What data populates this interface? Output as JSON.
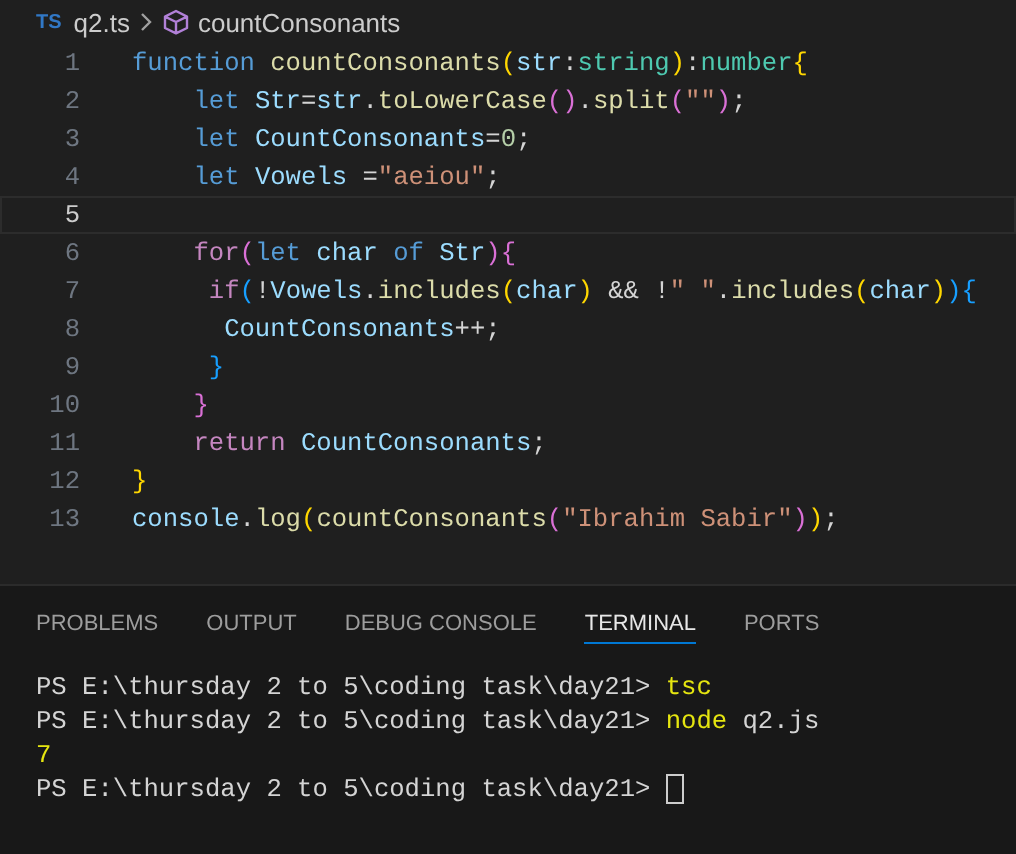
{
  "breadcrumbs": {
    "file_badge": "TS",
    "file": "q2.ts",
    "symbol": "countConsonants"
  },
  "editor": {
    "lines": [
      {
        "number": "1",
        "current": false,
        "tokens": [
          {
            "text": "function ",
            "kind": "keyword"
          },
          {
            "text": "countConsonants",
            "kind": "function"
          },
          {
            "text": "(",
            "kind": "bracket1"
          },
          {
            "text": "str",
            "kind": "variable"
          },
          {
            "text": ":",
            "kind": "plain"
          },
          {
            "text": "string",
            "kind": "type"
          },
          {
            "text": ")",
            "kind": "bracket1"
          },
          {
            "text": ":",
            "kind": "plain"
          },
          {
            "text": "number",
            "kind": "type"
          },
          {
            "text": "{",
            "kind": "bracket1"
          }
        ]
      },
      {
        "number": "2",
        "current": false,
        "tokens": [
          {
            "text": "    let",
            "kind": "keyword"
          },
          {
            "text": " Str",
            "kind": "variable"
          },
          {
            "text": "=",
            "kind": "plain"
          },
          {
            "text": "str",
            "kind": "variable"
          },
          {
            "text": ".",
            "kind": "plain"
          },
          {
            "text": "toLowerCase",
            "kind": "function"
          },
          {
            "text": "()",
            "kind": "bracket2"
          },
          {
            "text": ".",
            "kind": "plain"
          },
          {
            "text": "split",
            "kind": "function"
          },
          {
            "text": "(",
            "kind": "bracket2"
          },
          {
            "text": "\"\"",
            "kind": "string"
          },
          {
            "text": ")",
            "kind": "bracket2"
          },
          {
            "text": ";",
            "kind": "plain"
          }
        ]
      },
      {
        "number": "3",
        "current": false,
        "tokens": [
          {
            "text": "    let",
            "kind": "keyword"
          },
          {
            "text": " CountConsonants",
            "kind": "variable"
          },
          {
            "text": "=",
            "kind": "plain"
          },
          {
            "text": "0",
            "kind": "number"
          },
          {
            "text": ";",
            "kind": "plain"
          }
        ]
      },
      {
        "number": "4",
        "current": false,
        "tokens": [
          {
            "text": "    let",
            "kind": "keyword"
          },
          {
            "text": " Vowels",
            "kind": "variable"
          },
          {
            "text": " =",
            "kind": "plain"
          },
          {
            "text": "\"aeiou\"",
            "kind": "string"
          },
          {
            "text": ";",
            "kind": "plain"
          }
        ]
      },
      {
        "number": "5",
        "current": true
      },
      {
        "number": "6",
        "current": false,
        "tokens": [
          {
            "text": "    for",
            "kind": "control"
          },
          {
            "text": "(",
            "kind": "bracket2"
          },
          {
            "text": "let",
            "kind": "keyword"
          },
          {
            "text": " char ",
            "kind": "variable"
          },
          {
            "text": "of",
            "kind": "keyword"
          },
          {
            "text": " Str",
            "kind": "variable"
          },
          {
            "text": "){",
            "kind": "bracket2"
          }
        ]
      },
      {
        "number": "7",
        "current": false,
        "tokens": [
          {
            "text": "     if",
            "kind": "control"
          },
          {
            "text": "(",
            "kind": "bracket3"
          },
          {
            "text": "!",
            "kind": "plain"
          },
          {
            "text": "Vowels",
            "kind": "variable"
          },
          {
            "text": ".",
            "kind": "plain"
          },
          {
            "text": "includes",
            "kind": "function"
          },
          {
            "text": "(",
            "kind": "bracket1"
          },
          {
            "text": "char",
            "kind": "variable"
          },
          {
            "text": ")",
            "kind": "bracket1"
          },
          {
            "text": " && !",
            "kind": "plain"
          },
          {
            "text": "\" \"",
            "kind": "string"
          },
          {
            "text": ".",
            "kind": "plain"
          },
          {
            "text": "includes",
            "kind": "function"
          },
          {
            "text": "(",
            "kind": "bracket1"
          },
          {
            "text": "char",
            "kind": "variable"
          },
          {
            "text": ")",
            "kind": "bracket1"
          },
          {
            "text": "){",
            "kind": "bracket3"
          }
        ]
      },
      {
        "number": "8",
        "current": false,
        "tokens": [
          {
            "text": "      CountConsonants",
            "kind": "variable"
          },
          {
            "text": "++;",
            "kind": "plain"
          }
        ]
      },
      {
        "number": "9",
        "current": false,
        "tokens": [
          {
            "text": "     }",
            "kind": "bracket3"
          }
        ]
      },
      {
        "number": "10",
        "current": false,
        "tokens": [
          {
            "text": "    }",
            "kind": "bracket2"
          }
        ]
      },
      {
        "number": "11",
        "current": false,
        "tokens": [
          {
            "text": "    return",
            "kind": "control"
          },
          {
            "text": " CountConsonants",
            "kind": "variable"
          },
          {
            "text": ";",
            "kind": "plain"
          }
        ]
      },
      {
        "number": "12",
        "current": false,
        "tokens": [
          {
            "text": "}",
            "kind": "bracket1"
          }
        ]
      },
      {
        "number": "13",
        "current": false,
        "tokens": [
          {
            "text": "console",
            "kind": "variable"
          },
          {
            "text": ".",
            "kind": "plain"
          },
          {
            "text": "log",
            "kind": "function"
          },
          {
            "text": "(",
            "kind": "bracket1"
          },
          {
            "text": "countConsonants",
            "kind": "function"
          },
          {
            "text": "(",
            "kind": "bracket2"
          },
          {
            "text": "\"Ibrahim Sabir\"",
            "kind": "string"
          },
          {
            "text": ")",
            "kind": "bracket2"
          },
          {
            "text": ")",
            "kind": "bracket1"
          },
          {
            "text": ";",
            "kind": "plain"
          }
        ]
      }
    ]
  },
  "panel": {
    "tabs": [
      {
        "label": "PROBLEMS",
        "selected": false
      },
      {
        "label": "OUTPUT",
        "selected": false
      },
      {
        "label": "DEBUG CONSOLE",
        "selected": false
      },
      {
        "label": "TERMINAL",
        "selected": true
      },
      {
        "label": "PORTS",
        "selected": false
      }
    ],
    "terminal": [
      {
        "cursor": false,
        "tokens": [
          {
            "text": "PS E:\\thursday 2 to 5\\coding task\\day21> ",
            "kind": "plain"
          },
          {
            "text": "tsc",
            "kind": "command"
          }
        ]
      },
      {
        "cursor": false,
        "tokens": [
          {
            "text": "PS E:\\thursday 2 to 5\\coding task\\day21> ",
            "kind": "plain"
          },
          {
            "text": "node",
            "kind": "command"
          },
          {
            "text": " q2.js",
            "kind": "plain"
          }
        ]
      },
      {
        "cursor": false,
        "tokens": [
          {
            "text": "7",
            "kind": "command"
          }
        ]
      },
      {
        "cursor": true,
        "tokens": [
          {
            "text": "PS E:\\thursday 2 to 5\\coding task\\day21> ",
            "kind": "plain"
          }
        ]
      }
    ]
  }
}
